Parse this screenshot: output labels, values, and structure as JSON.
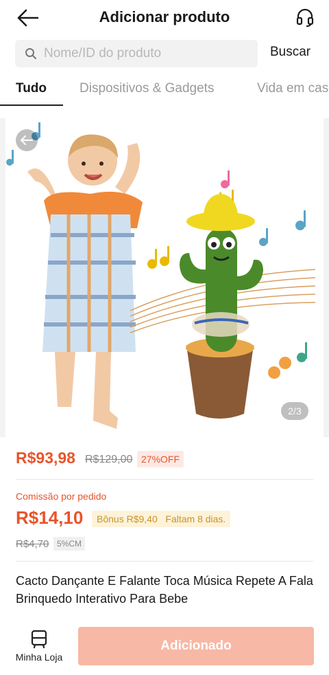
{
  "header": {
    "title": "Adicionar produto",
    "back_icon": "arrow-left-icon",
    "support_icon": "headset-icon"
  },
  "search": {
    "placeholder": "Nome/ID do produto",
    "value": "",
    "button_label": "Buscar"
  },
  "tabs": [
    {
      "label": "Tudo",
      "active": true
    },
    {
      "label": "Dispositivos & Gadgets",
      "active": false
    },
    {
      "label": "Vida em cas",
      "active": false
    }
  ],
  "gallery": {
    "counter": "2/3"
  },
  "product": {
    "price": "R$93,98",
    "original_price": "R$129,00",
    "discount": "27%OFF",
    "commission_label": "Comissão por pedido",
    "commission": "R$14,10",
    "bonus": "Bônus R$9,40   Faltam 8 dias.",
    "original_commission": "R$4,70",
    "commission_rate": "5%CM",
    "title": "Cacto Dançante E Falante Toca Música Repete A Fala Brinquedo Interativo Para Bebe"
  },
  "bottom_bar": {
    "store_label": "Minha Loja",
    "add_button_label": "Adicionado"
  },
  "colors": {
    "accent": "#e8542b",
    "add_button_disabled": "#f7b8a5",
    "bonus_text": "#c9932a"
  }
}
